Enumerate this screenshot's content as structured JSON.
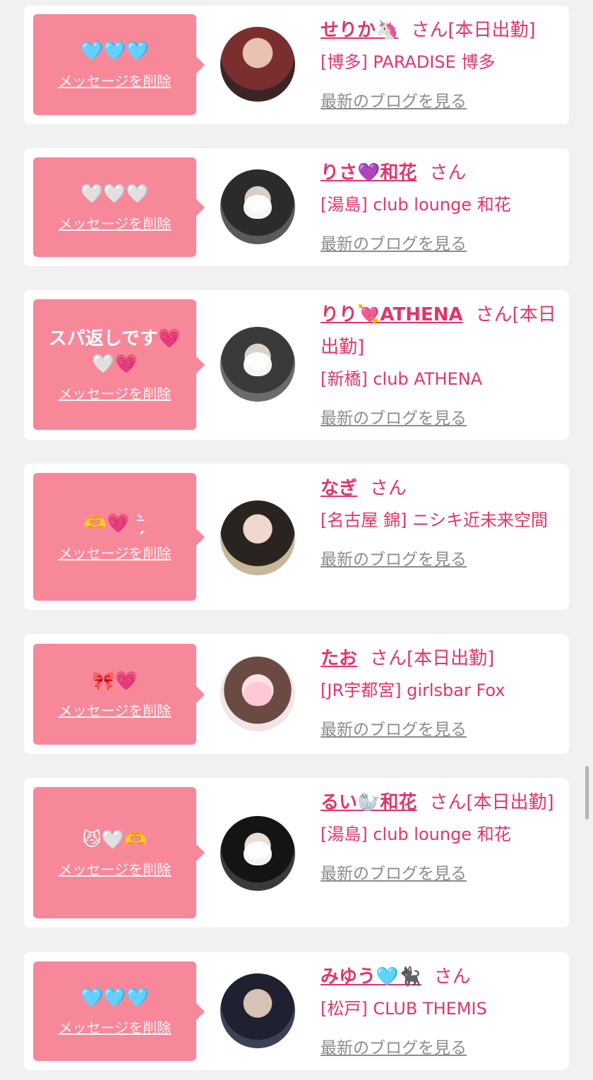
{
  "delete_label": "メッセージを削除",
  "blog_label": "最新のブログを見る",
  "suffix": "さん",
  "accent_color": "#e0356b",
  "bubble_color": "#f7889a",
  "items": [
    {
      "message": "🩵🩵🩵",
      "name": "せりか🦄",
      "status": "[本日出勤]",
      "shop": "[博多] PARADISE 博多"
    },
    {
      "message": "🤍🤍🤍",
      "name": "りさ💜和花",
      "status": "",
      "shop": "[湯島] club lounge 和花"
    },
    {
      "message": "スパ返しです💗🤍💗",
      "name": "りり💘ATHENA",
      "status": "[本日出勤]",
      "shop": "[新橋] club ATHENA"
    },
    {
      "message": "🫶💗 ⁻̗̀",
      "name": "なぎ",
      "status": "",
      "shop": "[名古屋 錦] ニシキ近未来空間"
    },
    {
      "message": "🎀💗",
      "name": "たお",
      "status": "[本日出勤]",
      "shop": "[JR宇都宮] girlsbar Fox"
    },
    {
      "message": "😼🤍🫶",
      "name": "るい🦭和花",
      "status": "[本日出勤]",
      "shop": "[湯島] club lounge 和花"
    },
    {
      "message": "🩵🩵🩵",
      "name": "みゆう🩵🐈‍⬛",
      "status": "",
      "shop": "[松戸] CLUB THEMIS"
    }
  ]
}
